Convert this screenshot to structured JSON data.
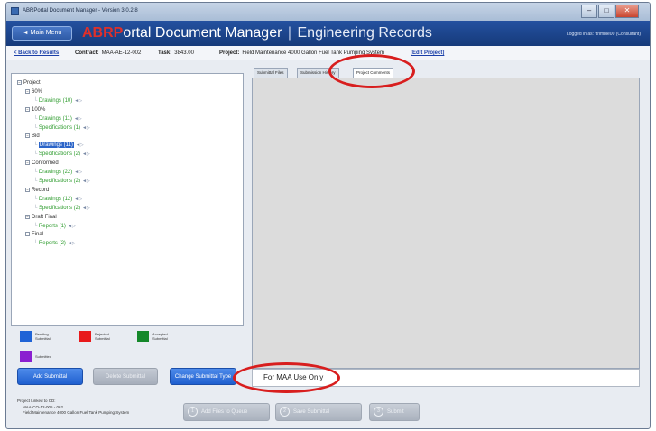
{
  "window": {
    "title": "ABRPortal Document Manager - Version 3.0.2.8",
    "controls": {
      "minimize": "–",
      "maximize": "□",
      "close": "✕"
    }
  },
  "header": {
    "menu_button": "◄ Main Menu",
    "brand": "ABRP",
    "title": "ortal Document Manager",
    "separator": "|",
    "subtitle": "Engineering Records",
    "logged_in": "Logged in as: \\trimble00 (Consultant)"
  },
  "infobar": {
    "back_link": "< Back to Results",
    "contract_label": "Contract:",
    "contract_value": "MAA-AE-12-002",
    "task_label": "Task:",
    "task_value": "3843.00",
    "project_label": "Project:",
    "project_value": "Field Maintenance 4000 Gallon Fuel Tank Pumping System",
    "edit_link": "[Edit Project]"
  },
  "tree": [
    {
      "level": 0,
      "type": "folder",
      "label": "Project",
      "expander": "−"
    },
    {
      "level": 1,
      "type": "folder",
      "label": "60%",
      "expander": "−"
    },
    {
      "level": 2,
      "type": "leaf",
      "label": "Drawings (10)",
      "icon": "◄▷"
    },
    {
      "level": 1,
      "type": "folder",
      "label": "100%",
      "expander": "−"
    },
    {
      "level": 2,
      "type": "leaf",
      "label": "Drawings (11)",
      "icon": "◄▷"
    },
    {
      "level": 2,
      "type": "leaf",
      "label": "Specifications (1)",
      "icon": "◄▷"
    },
    {
      "level": 1,
      "type": "folder",
      "label": "Bid",
      "expander": "−"
    },
    {
      "level": 2,
      "type": "leaf",
      "label": "Drawings (11)",
      "icon": "◄▷",
      "selected": true
    },
    {
      "level": 2,
      "type": "leaf",
      "label": "Specifications (2)",
      "icon": "◄▷"
    },
    {
      "level": 1,
      "type": "folder",
      "label": "Conformed",
      "expander": "−"
    },
    {
      "level": 2,
      "type": "leaf",
      "label": "Drawings (22)",
      "icon": "◄▷"
    },
    {
      "level": 2,
      "type": "leaf",
      "label": "Specifications (2)",
      "icon": "◄▷"
    },
    {
      "level": 1,
      "type": "folder",
      "label": "Record",
      "expander": "−"
    },
    {
      "level": 2,
      "type": "leaf",
      "label": "Drawings (12)",
      "icon": "◄▷"
    },
    {
      "level": 2,
      "type": "leaf",
      "label": "Specifications (2)",
      "icon": "◄▷"
    },
    {
      "level": 1,
      "type": "folder",
      "label": "Draft Final",
      "expander": "−"
    },
    {
      "level": 2,
      "type": "leaf",
      "label": "Reports (1)",
      "icon": "◄▷"
    },
    {
      "level": 1,
      "type": "folder",
      "label": "Final",
      "expander": "−"
    },
    {
      "level": 2,
      "type": "leaf",
      "label": "Reports (2)",
      "icon": "◄▷"
    }
  ],
  "legend": {
    "pending": {
      "line1": "Pending",
      "line2": "Submittal",
      "color": "#1f63d6"
    },
    "rejected": {
      "line1": "Rejected",
      "line2": "Submittal",
      "color": "#e8191b"
    },
    "accepted": {
      "line1": "Accepted",
      "line2": "Submittal",
      "color": "#14882a"
    },
    "submitted": {
      "line1": "Submitted",
      "color": "#8a1fd0"
    }
  },
  "left_buttons": {
    "add": "Add Submittal",
    "delete": "Delete Submittal",
    "change": "Change Submittal Type"
  },
  "tabs": [
    "Submittal Files",
    "Submission History",
    "Project Comments"
  ],
  "active_tab": 2,
  "maa_note": "For MAA Use Only",
  "project_info": {
    "line1": "Project Linked to CD:",
    "line2": "MAA-CO-12-005 - 062",
    "line3": "Field Maintenance 4000 Gallon Fuel Tank Pumping System"
  },
  "footer_buttons": {
    "add_files": {
      "label": "Add Files to Queue",
      "number": "1"
    },
    "save": {
      "label": "Save Submittal",
      "number": "2"
    },
    "submit": {
      "label": "Submit",
      "number": "3"
    }
  }
}
